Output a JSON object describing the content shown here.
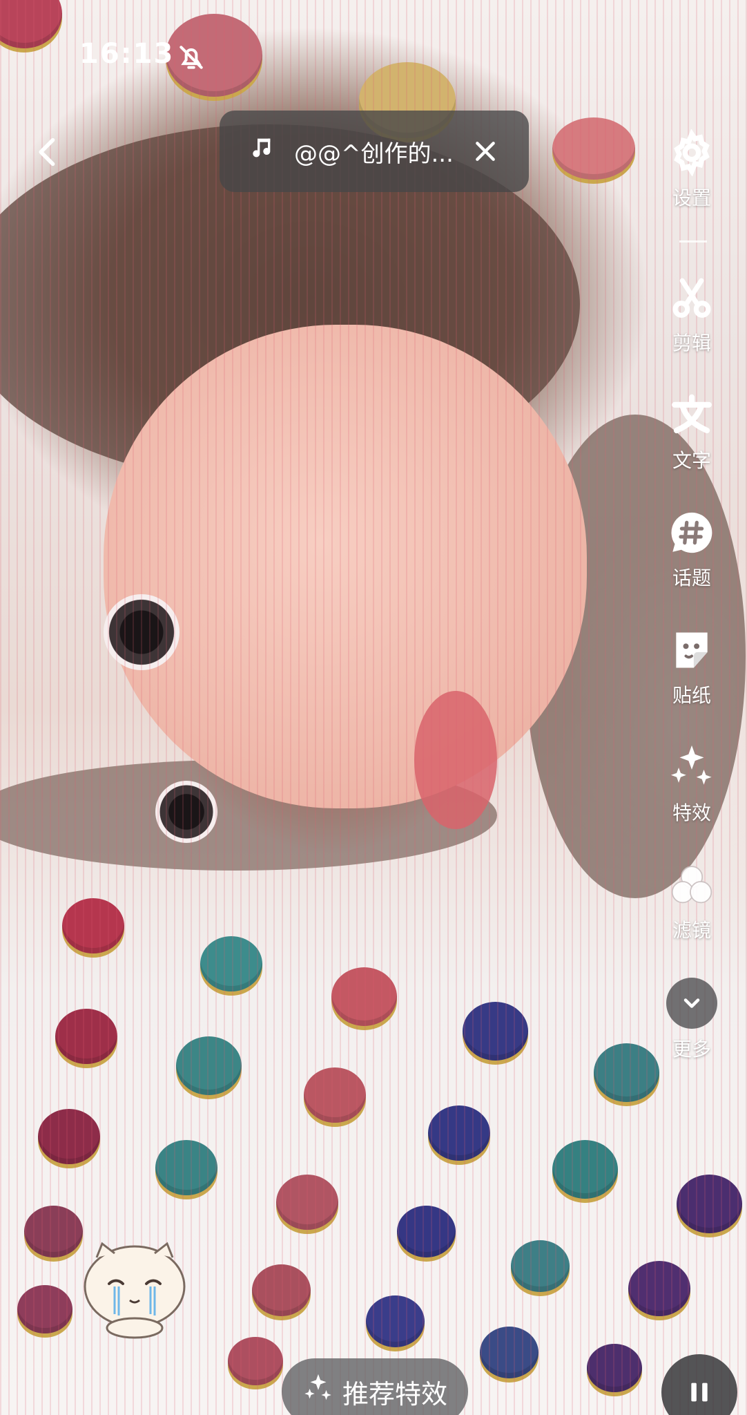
{
  "status_bar": {
    "time": "16:13",
    "right": ""
  },
  "music": {
    "title": "@@^创作的..."
  },
  "toolbar": {
    "items": [
      {
        "label": "设置",
        "icon": "gear-icon"
      },
      {
        "label": "剪辑",
        "icon": "scissors-icon"
      },
      {
        "label": "文字",
        "icon": "text-icon"
      },
      {
        "label": "话题",
        "icon": "hashtag-icon"
      },
      {
        "label": "贴纸",
        "icon": "sticker-icon"
      },
      {
        "label": "特效",
        "icon": "sparkles-icon"
      },
      {
        "label": "滤镜",
        "icon": "filter-icon"
      },
      {
        "label": "更多",
        "icon": "chevron-down-icon"
      }
    ]
  },
  "bottom": {
    "recommend_label": "推荐特效"
  }
}
